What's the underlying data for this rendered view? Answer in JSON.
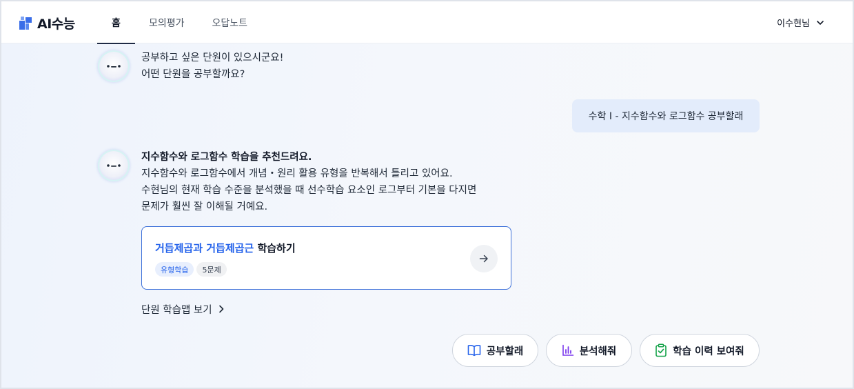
{
  "app": {
    "logo_text": "AI수능"
  },
  "nav": {
    "tabs": [
      {
        "label": "홈",
        "active": true
      },
      {
        "label": "모의평가",
        "active": false
      },
      {
        "label": "오답노트",
        "active": false
      }
    ]
  },
  "user": {
    "name": "이수현님",
    "icon": "chevron-down-icon"
  },
  "chat": {
    "bot_message_1": {
      "lines": [
        "공부하고 싶은 단원이 있으시군요!",
        "어떤 단원을 공부할까요?"
      ]
    },
    "user_message": "수학 I - 지수함수와 로그함수 공부할래",
    "bot_message_2": {
      "title": "지수함수와 로그함수 학습을 추천드려요.",
      "lines": [
        "지수함수와 로그함수에서 개념・원리 활용 유형을 반복해서 틀리고 있어요.",
        "수현님의 현재 학습 수준을 분석했을 때 선수학습 요소인 로그부터 기본을 다지면",
        "문제가 훨씬 잘 이해될 거예요."
      ]
    },
    "recommend_card": {
      "title_highlight": "거듭제곱과 거듭제곱근",
      "title_rest": " 학습하기",
      "chips": [
        "유형학습",
        "5문제"
      ],
      "icon": "arrow-right-icon"
    },
    "unit_map_link": "단원 학습맵 보기"
  },
  "actions": [
    {
      "label": "공부할래",
      "icon": "book-icon"
    },
    {
      "label": "분석해줘",
      "icon": "bar-chart-icon"
    },
    {
      "label": "학습 이력 보여줘",
      "icon": "clipboard-check-icon"
    }
  ],
  "colors": {
    "accent": "#2563eb",
    "user_bubble": "#e3ecfb",
    "nav_active": "#1f2a44",
    "analysis_icon": "#7c3aed",
    "history_icon": "#16a34a"
  }
}
